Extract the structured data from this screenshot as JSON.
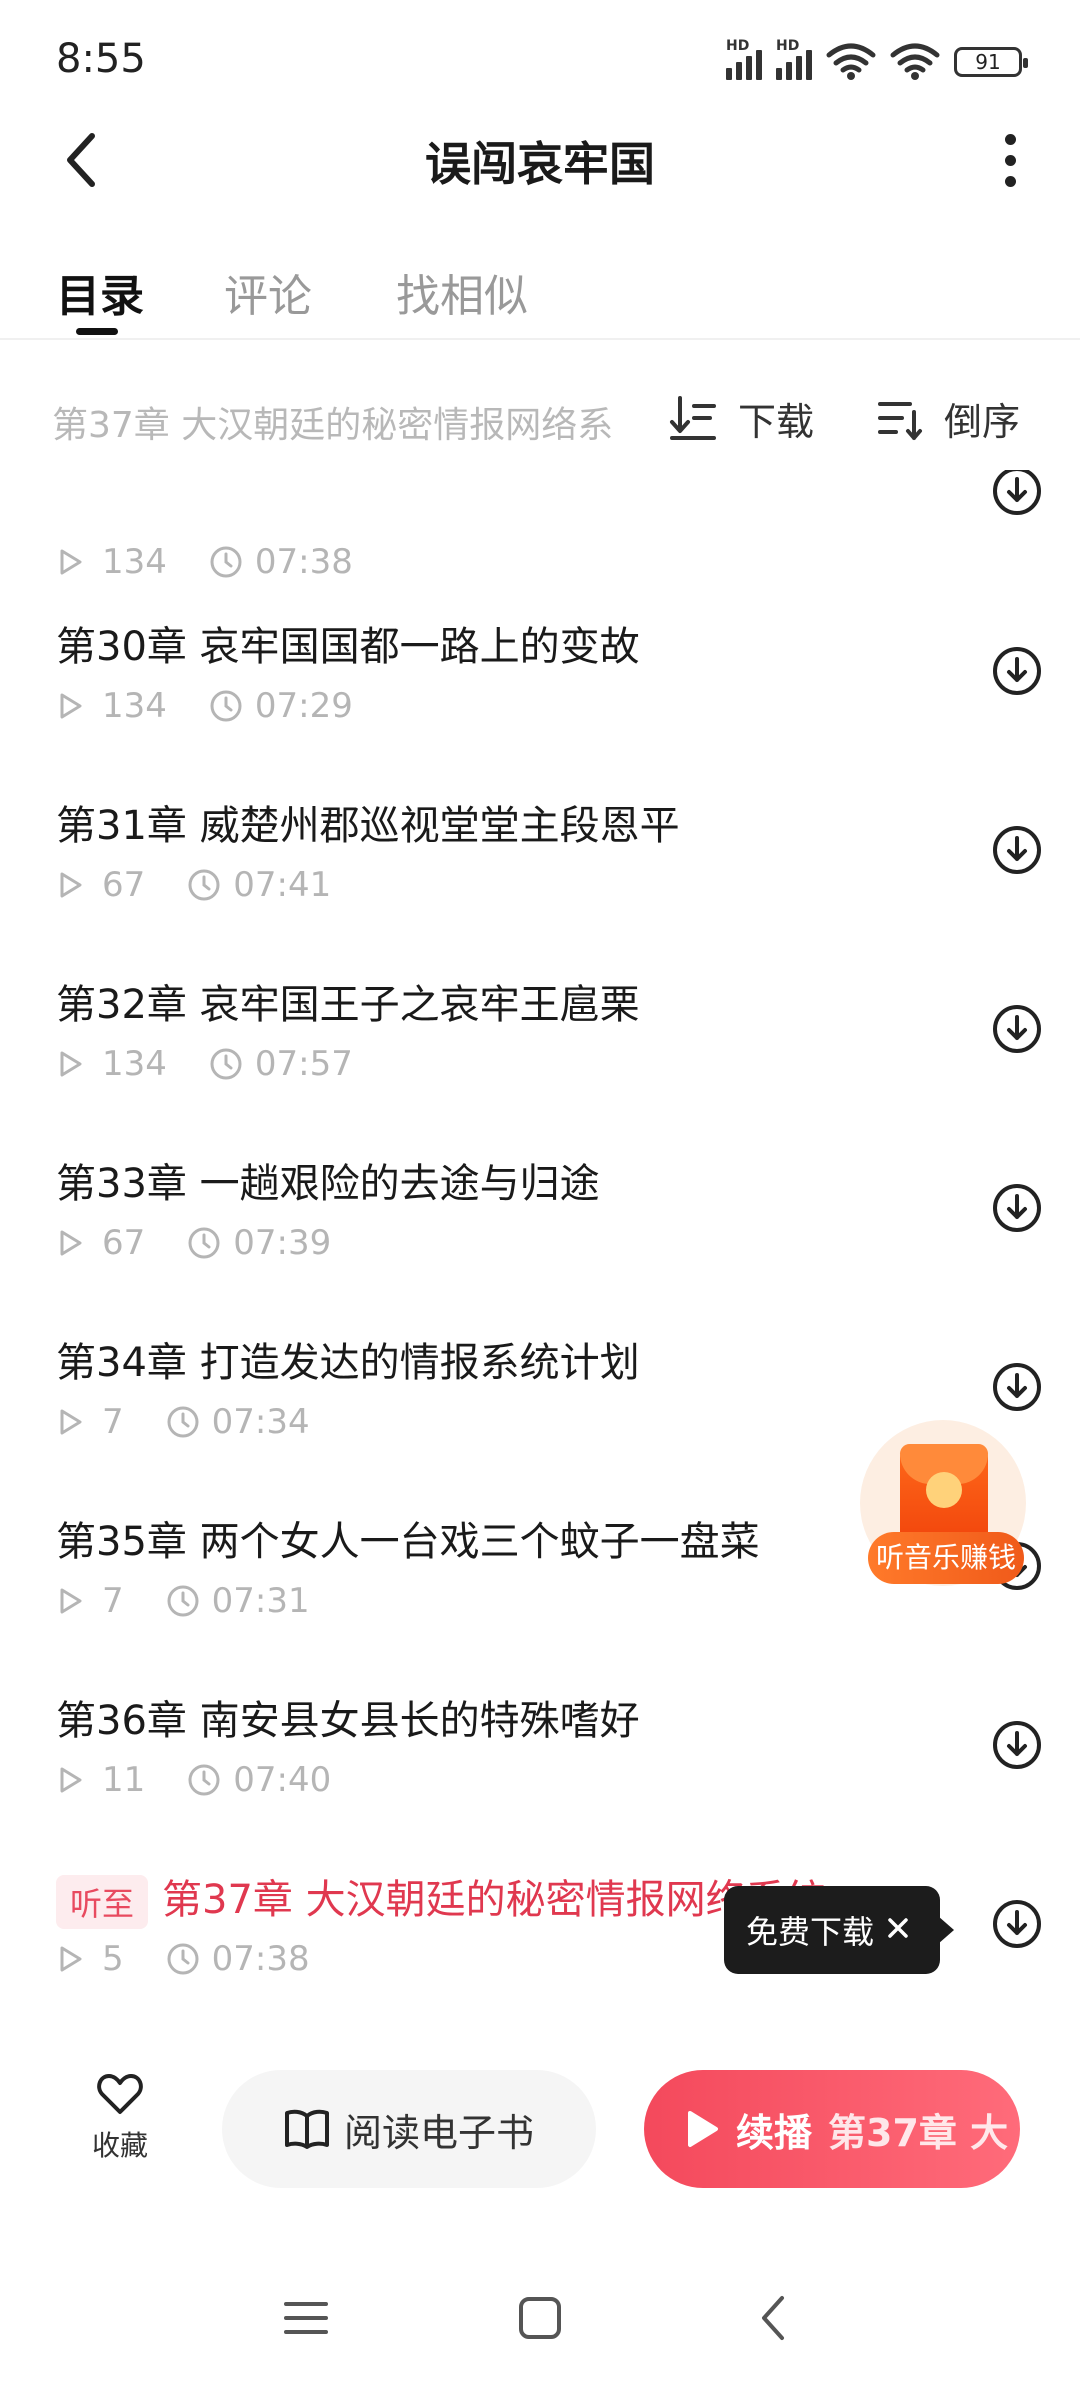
{
  "status": {
    "time": "8:55",
    "battery": "91",
    "signal_tag": "HD"
  },
  "header": {
    "title": "误闯哀牢国"
  },
  "tabs": [
    {
      "label": "目录",
      "active": true
    },
    {
      "label": "评论",
      "active": false
    },
    {
      "label": "找相似",
      "active": false
    }
  ],
  "toolbar": {
    "current_hint": "第37章 大汉朝廷的秘密情报网络系",
    "download_label": "下载",
    "sort_label": "倒序"
  },
  "chapters": [
    {
      "title": "",
      "plays": "134",
      "duration": "07:38"
    },
    {
      "title": "第30章 哀牢国国都一路上的变故",
      "plays": "134",
      "duration": "07:29"
    },
    {
      "title": "第31章 威楚州郡巡视堂堂主段恩平",
      "plays": "67",
      "duration": "07:41"
    },
    {
      "title": "第32章 哀牢国王子之哀牢王扈栗",
      "plays": "134",
      "duration": "07:57"
    },
    {
      "title": "第33章 一趟艰险的去途与归途",
      "plays": "67",
      "duration": "07:39"
    },
    {
      "title": "第34章 打造发达的情报系统计划",
      "plays": "7",
      "duration": "07:34"
    },
    {
      "title": "第35章 两个女人一台戏三个蚊子一盘菜",
      "plays": "7",
      "duration": "07:31"
    },
    {
      "title": "第36章 南安县女县长的特殊嗜好",
      "plays": "11",
      "duration": "07:40"
    },
    {
      "title": "第37章 大汉朝廷的秘密情报网络系统",
      "plays": "5",
      "duration": "07:38",
      "badge": "听至"
    }
  ],
  "reward": {
    "label": "听音乐赚钱"
  },
  "tooltip": {
    "label": "免费下载"
  },
  "action_bar": {
    "fav_label": "收藏",
    "read_label": "阅读电子书",
    "resume_label": "续播",
    "resume_chapter": "第37章 大"
  },
  "colors": {
    "accent": "#f4495c",
    "current_chapter": "#e0384f",
    "muted": "#b5b5b5"
  }
}
